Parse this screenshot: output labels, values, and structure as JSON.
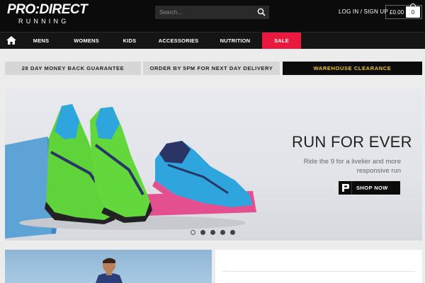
{
  "header": {
    "logo_main": "PRO:DIRECT",
    "logo_sub": "RUNNING",
    "search_placeholder": "Search...",
    "login_label": "LOG IN / SIGN UP",
    "cart_total": "£0.00",
    "cart_count": "0"
  },
  "nav": {
    "items": [
      {
        "label": "MENS"
      },
      {
        "label": "WOMENS"
      },
      {
        "label": "KIDS"
      },
      {
        "label": "ACCESSORIES"
      },
      {
        "label": "NUTRITION"
      },
      {
        "label": "SALE"
      }
    ]
  },
  "promo": {
    "items": [
      {
        "label": "28 DAY MONEY BACK GUARANTEE"
      },
      {
        "label": "ORDER BY 5PM FOR NEXT DAY DELIVERY"
      },
      {
        "label": "WAREHOUSE CLEARANCE"
      }
    ]
  },
  "hero": {
    "title": "RUN FOR EVER",
    "subtitle": "Ride the 9 for a livelier and more responsive run",
    "cta_label": "SHOP NOW",
    "slide_count": 5,
    "active_slide": 1
  },
  "colors": {
    "sale": "#e8193c",
    "clearance_text": "#f2c61f",
    "shoe_green": "#5fd33a",
    "shoe_blue": "#2ea6dd",
    "shoe_navy": "#2a3566"
  },
  "icons": {
    "search": "search-icon",
    "home": "home-icon",
    "cart": "cart-bag-icon",
    "brand": "p-logo-icon"
  }
}
